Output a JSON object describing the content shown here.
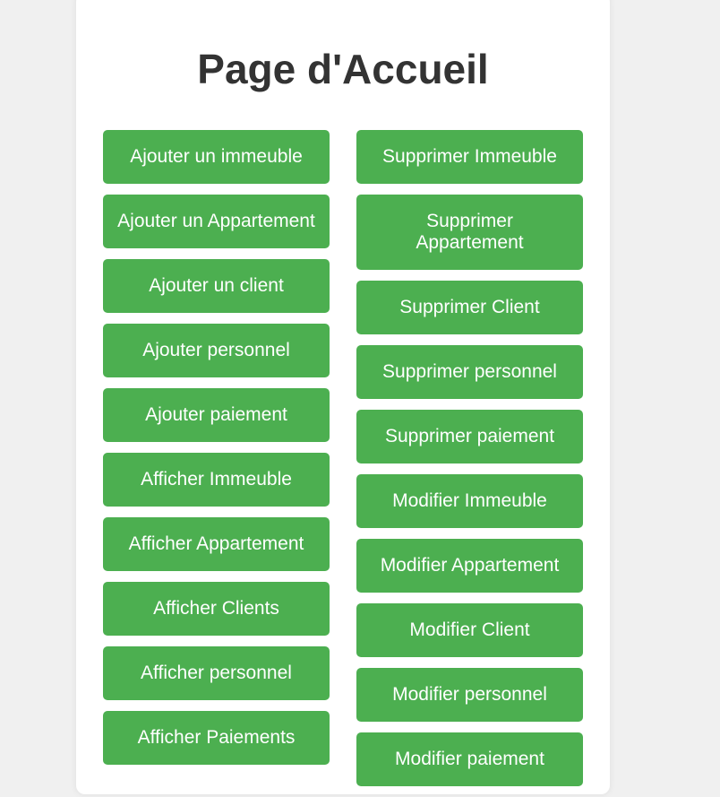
{
  "title": "Page d'Accueil",
  "left_buttons": [
    "Ajouter un immeuble",
    "Ajouter un Appartement",
    "Ajouter un client",
    "Ajouter personnel",
    "Ajouter paiement",
    "Afficher Immeuble",
    "Afficher Appartement",
    "Afficher Clients",
    "Afficher personnel",
    "Afficher Paiements"
  ],
  "right_buttons": [
    "Supprimer Immeuble",
    "Supprimer Appartement",
    "Supprimer Client",
    "Supprimer personnel",
    "Supprimer paiement",
    "Modifier Immeuble",
    "Modifier Appartement",
    "Modifier Client",
    "Modifier personnel",
    "Modifier paiement"
  ],
  "colors": {
    "button": "#4caf50",
    "title": "#333333"
  }
}
